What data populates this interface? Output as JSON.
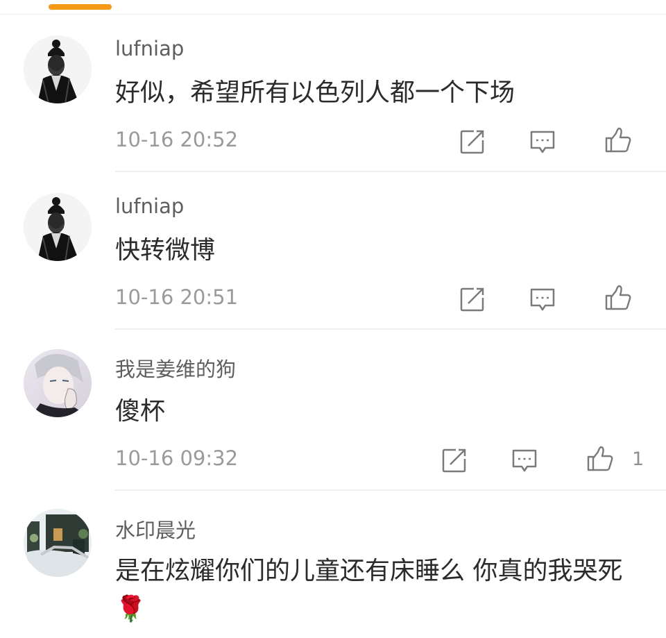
{
  "colors": {
    "accent": "#f49a14",
    "username": "#5e5e5e",
    "text": "#2b2b2b",
    "meta": "#9a9a9a"
  },
  "comments": [
    {
      "username": "lufniap",
      "text": "好似，希望所有以色列人都一个下场",
      "time": "10-16 20:52",
      "likes": ""
    },
    {
      "username": "lufniap",
      "text": "快转微博",
      "time": "10-16 20:51",
      "likes": ""
    },
    {
      "username": "我是姜维的狗",
      "text": "傻杯",
      "time": "10-16 09:32",
      "likes": "1"
    },
    {
      "username": "水印晨光",
      "text": "是在炫耀你们的儿童还有床睡么 你真的我哭死🌹",
      "time": "",
      "likes": ""
    }
  ],
  "icons": {
    "repost": "repost-icon",
    "comment": "comment-icon",
    "like": "thumbs-up-icon"
  }
}
